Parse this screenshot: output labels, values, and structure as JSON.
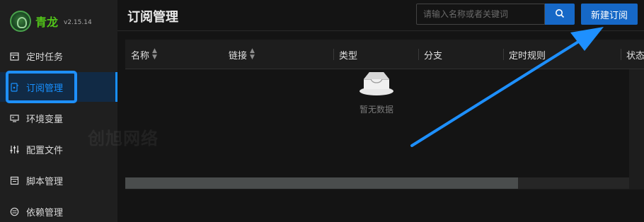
{
  "brand": {
    "name": "青龙",
    "version": "v2.15.14"
  },
  "sidebar": {
    "items": [
      {
        "label": "定时任务",
        "icon": "calendar-icon"
      },
      {
        "label": "订阅管理",
        "icon": "subscription-icon",
        "active": true
      },
      {
        "label": "环境变量",
        "icon": "monitor-icon"
      },
      {
        "label": "配置文件",
        "icon": "sliders-icon"
      },
      {
        "label": "脚本管理",
        "icon": "code-file-icon"
      },
      {
        "label": "依赖管理",
        "icon": "dependency-icon"
      }
    ]
  },
  "header": {
    "title": "订阅管理",
    "search_placeholder": "请输入名称或者关键词",
    "search_icon": "search-icon",
    "new_button": "新建订阅"
  },
  "table": {
    "columns": [
      {
        "label": "名称",
        "sortable": true
      },
      {
        "label": "链接",
        "sortable": true
      },
      {
        "label": "类型",
        "sortable": false
      },
      {
        "label": "分支",
        "sortable": false
      },
      {
        "label": "定时规则",
        "sortable": false
      },
      {
        "label": "状态",
        "sortable": false
      }
    ],
    "empty_text": "暂无数据",
    "horizontal_scroll_visible_fraction": 0.78
  },
  "watermark": "创旭网络",
  "colors": {
    "accent": "#1890ff",
    "brand_green": "#52c41a",
    "annotation_blue": "#1e90ff"
  }
}
